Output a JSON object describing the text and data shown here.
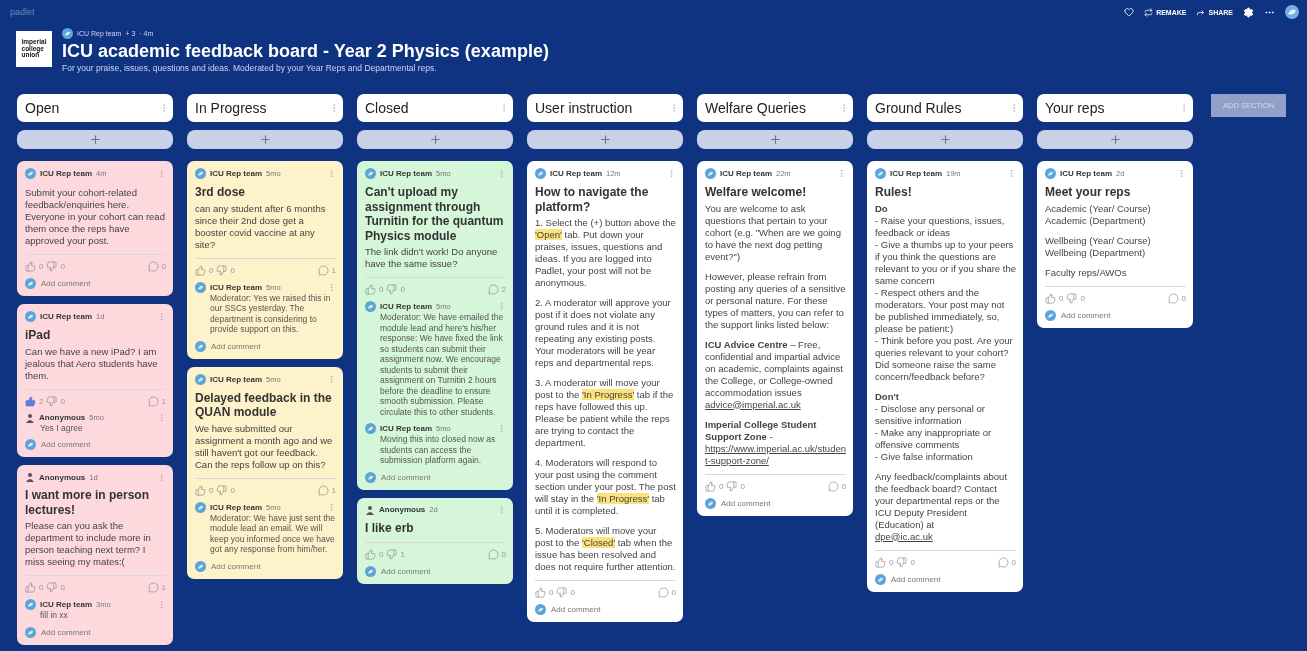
{
  "top_bar": {
    "app_name": "padlet",
    "actions": [
      {
        "kind": "heart"
      },
      {
        "kind": "remake",
        "label": "REMAKE"
      },
      {
        "kind": "share",
        "label": "SHARE"
      },
      {
        "kind": "settings"
      },
      {
        "kind": "more"
      },
      {
        "kind": "avatar"
      }
    ]
  },
  "header": {
    "logo_lines": [
      "imperial",
      "college",
      "union"
    ],
    "author": "ICU Rep team",
    "contributors": "+ 3",
    "time": "· 4m",
    "title": "ICU academic feedback board - Year 2 Physics (example)",
    "subtitle": "For your praise, issues, questions and ideas. Moderated by your Year Reps and Departmental reps."
  },
  "add_section": "ADD SECTION",
  "columns": [
    {
      "title": "Open",
      "color": "#fdd9dd",
      "posts": [
        {
          "author": "ICU Rep team",
          "kind": "team",
          "time": "4m",
          "body": [
            [
              [
                {
                  "kind": "text",
                  "text": "Submit your cohort-related feedback/enquiries here. Everyone in your cohort can read them once the reps have approved your post."
                }
              ]
            ]
          ],
          "likes": "0",
          "liked": false,
          "dislikes": "0",
          "comment_count": "0",
          "add_comment": "Add comment"
        },
        {
          "author": "ICU Rep team",
          "kind": "team",
          "time": "1d",
          "title": "iPad",
          "body": [
            [
              [
                {
                  "kind": "text",
                  "text": "Can we have a new iPad? I am jealous that Aero students have them."
                }
              ]
            ]
          ],
          "likes": "2",
          "liked": true,
          "dislikes": "0",
          "comment_count": "1",
          "comments": [
            {
              "author": "Anonymous",
              "kind": "anonymous",
              "time": "5mo",
              "text": "Yes I agree"
            }
          ],
          "add_comment": "Add comment"
        },
        {
          "author": "Anonymous",
          "kind": "anonymous",
          "time": "1d",
          "title": "I want more in person lectures!",
          "body": [
            [
              [
                {
                  "kind": "text",
                  "text": "Please can you ask the department to include more in person teaching next term? I miss seeing my mates:("
                }
              ]
            ]
          ],
          "likes": "0",
          "liked": false,
          "dislikes": "0",
          "comment_count": "1",
          "comments": [
            {
              "author": "ICU Rep team",
              "kind": "team",
              "time": "3mo",
              "text": "fill in xx"
            }
          ],
          "add_comment": "Add comment"
        }
      ]
    },
    {
      "title": "In Progress",
      "color": "#fdf2c9",
      "posts": [
        {
          "author": "ICU Rep team",
          "kind": "team",
          "time": "5mo",
          "title": "3rd dose",
          "body": [
            [
              [
                {
                  "kind": "text",
                  "text": "can any student after 6 months since their 2nd dose get a booster covid vaccine at any site?"
                }
              ]
            ]
          ],
          "likes": "0",
          "liked": false,
          "dislikes": "0",
          "comment_count": "1",
          "comments": [
            {
              "author": "ICU Rep team",
              "kind": "team",
              "time": "5mo",
              "text": "Moderator: Yes we raised this in our SSCs yesterday. The department is considering to provide support on this."
            }
          ],
          "add_comment": "Add comment"
        },
        {
          "author": "ICU Rep team",
          "kind": "team",
          "time": "5mo",
          "title": "Delayed feedback in the QUAN module",
          "body": [
            [
              [
                {
                  "kind": "text",
                  "text": "We have submitted our assignment a month ago and we still haven't got our feedback. Can the reps follow up on this?"
                }
              ]
            ]
          ],
          "likes": "0",
          "liked": false,
          "dislikes": "0",
          "comment_count": "1",
          "comments": [
            {
              "author": "ICU Rep team",
              "kind": "team",
              "time": "5mo",
              "text": "Moderator: We have just sent the module lead an email. We will keep you informed once we have got any response from him/her."
            }
          ],
          "add_comment": "Add comment"
        }
      ]
    },
    {
      "title": "Closed",
      "color": "#d6f6da",
      "posts": [
        {
          "author": "ICU Rep team",
          "kind": "team",
          "time": "5mo",
          "title": "Can't upload my assignment through Turnitin for the quantum Physics module",
          "body": [
            [
              [
                {
                  "kind": "text",
                  "text": "The link didn't work! Do anyone have the same issue?"
                }
              ]
            ]
          ],
          "likes": "0",
          "liked": false,
          "dislikes": "0",
          "comment_count": "2",
          "comments": [
            {
              "author": "ICU Rep team",
              "kind": "team",
              "time": "5mo",
              "text": "Moderator: We have emailed the module lead and here's his/her response: We have fixed the link so students can submit their assignment now. We encourage students to submit their assignment on Turnitin 2 hours before the deadline to ensure smooth submission. Please circulate this to other students."
            },
            {
              "author": "ICU Rep team",
              "kind": "team",
              "time": "5mo",
              "text": "Moving this into closed now as students can access the submission platform again."
            }
          ],
          "add_comment": "Add comment"
        },
        {
          "author": "Anonymous",
          "kind": "anonymous",
          "time": "2d",
          "title": "I like erb",
          "likes": "0",
          "liked": false,
          "dislikes": "1",
          "comment_count": "0",
          "add_comment": "Add comment"
        }
      ]
    },
    {
      "title": "User instruction",
      "color": "#ffffff",
      "posts": [
        {
          "author": "ICU Rep team",
          "kind": "team",
          "time": "12m",
          "title": "How to navigate the platform?",
          "body": [
            [
              [
                {
                  "kind": "text",
                  "text": "1. Select the (+) button above the "
                },
                {
                  "kind": "mark",
                  "text": "'Open'"
                },
                {
                  "kind": "text",
                  "text": " tab. Put down your praises, issues, questions and ideas. If you are logged into Padlet, your post will not be anonymous."
                }
              ]
            ],
            [
              [
                {
                  "kind": "text",
                  "text": "2. A moderator will approve your post if it does not violate any ground rules and it is not repeating any existing posts. Your moderators will be year reps and departmental reps."
                }
              ]
            ],
            [
              [
                {
                  "kind": "text",
                  "text": "3. A moderator will move your post to the "
                },
                {
                  "kind": "mark",
                  "text": "'In Progress'"
                },
                {
                  "kind": "text",
                  "text": " tab if the reps have followed this up. Please be patient while the reps are trying to contact the department."
                }
              ]
            ],
            [
              [
                {
                  "kind": "text",
                  "text": "4. Moderators will respond to your post using the comment section under your post. The post will stay in the "
                },
                {
                  "kind": "mark",
                  "text": "'In Progress'"
                },
                {
                  "kind": "text",
                  "text": " tab until it is completed."
                }
              ]
            ],
            [
              [
                {
                  "kind": "text",
                  "text": "5. Moderators will move your post to the "
                },
                {
                  "kind": "mark",
                  "text": "'Closed'"
                },
                {
                  "kind": "text",
                  "text": " tab when the issue has been resolved and does not require further attention."
                }
              ]
            ]
          ],
          "likes": "0",
          "liked": false,
          "dislikes": "0",
          "comment_count": "0",
          "add_comment": "Add comment"
        }
      ]
    },
    {
      "title": "Welfare Queries",
      "color": "#ffffff",
      "posts": [
        {
          "author": "ICU Rep team",
          "kind": "team",
          "time": "22m",
          "title": "Welfare welcome!",
          "body": [
            [
              [
                {
                  "kind": "text",
                  "text": "You are welcome to ask questions that pertain to your cohort (e.g. \"When are we going to have the next dog petting event?\")"
                }
              ]
            ],
            [
              [
                {
                  "kind": "text",
                  "text": "However, please refrain from posting any queries of a sensitive or personal nature. For these types of matters, you can refer to the support links listed below:"
                }
              ]
            ],
            [
              [
                {
                  "kind": "bold",
                  "text": "ICU Advice Centre"
                },
                {
                  "kind": "text",
                  "text": " – Free, confidential and impartial advice on academic, complaints against the College, or College-owned accommodation issues"
                }
              ],
              [
                {
                  "kind": "link",
                  "text": "advice@imperial.ac.uk"
                }
              ]
            ],
            [
              [
                {
                  "kind": "bold",
                  "text": "Imperial College Student Support Zone"
                },
                {
                  "kind": "text",
                  "text": " -"
                }
              ],
              [
                {
                  "kind": "link",
                  "text": "https://www.imperial.ac.uk/student-support-zone/"
                }
              ]
            ]
          ],
          "likes": "0",
          "liked": false,
          "dislikes": "0",
          "comment_count": "0",
          "add_comment": "Add comment"
        }
      ]
    },
    {
      "title": "Ground Rules",
      "color": "#ffffff",
      "posts": [
        {
          "author": "ICU Rep team",
          "kind": "team",
          "time": "19m",
          "title": "Rules!",
          "body": [
            [
              [
                {
                  "kind": "bold",
                  "text": "Do"
                }
              ],
              [
                {
                  "kind": "text",
                  "text": "- Raise your questions, issues, feedback or ideas"
                }
              ],
              [
                {
                  "kind": "text",
                  "text": "- Give a thumbs up to your peers if you think the questions are relevant to you or if you share the same concern"
                }
              ],
              [
                {
                  "kind": "text",
                  "text": "- Respect others and the moderators. Your post may not be published immediately, so, please be patient:)"
                }
              ],
              [
                {
                  "kind": "text",
                  "text": "- Think before you post. Are your queries relevant to your cohort? Did someone raise the same concern/feedback before?"
                }
              ]
            ],
            [
              [
                {
                  "kind": "bold",
                  "text": "Don't"
                }
              ],
              [
                {
                  "kind": "text",
                  "text": "- Disclose any personal or sensitive information"
                }
              ],
              [
                {
                  "kind": "text",
                  "text": "- Make any inappropriate or offensive comments"
                }
              ],
              [
                {
                  "kind": "text",
                  "text": "- Give false information"
                }
              ]
            ],
            [
              [
                {
                  "kind": "text",
                  "text": "Any feedback/complaints about the feedback board? Contact your departmental reps or the ICU Deputy President (Education) at"
                }
              ],
              [
                {
                  "kind": "link",
                  "text": "dpe@ic.ac.uk"
                }
              ]
            ]
          ],
          "likes": "0",
          "liked": false,
          "dislikes": "0",
          "comment_count": "0",
          "add_comment": "Add comment"
        }
      ]
    },
    {
      "title": "Your reps",
      "color": "#ffffff",
      "posts": [
        {
          "author": "ICU Rep team",
          "kind": "team",
          "time": "2d",
          "title": "Meet your reps",
          "body": [
            [
              [
                {
                  "kind": "text",
                  "text": "Academic (Year/ Course)"
                }
              ],
              [
                {
                  "kind": "text",
                  "text": "Academic (Department)"
                }
              ]
            ],
            [
              [
                {
                  "kind": "text",
                  "text": "Wellbeing (Year/ Course)"
                }
              ],
              [
                {
                  "kind": "text",
                  "text": "Wellbeing (Department)"
                }
              ]
            ],
            [
              [
                {
                  "kind": "text",
                  "text": "Faculty reps/AWOs"
                }
              ]
            ]
          ],
          "likes": "0",
          "liked": false,
          "dislikes": "0",
          "comment_count": "0",
          "add_comment": "Add comment"
        }
      ]
    }
  ]
}
